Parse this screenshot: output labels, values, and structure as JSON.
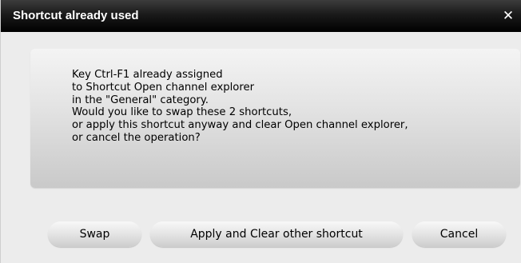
{
  "dialog": {
    "title": "Shortcut already used",
    "close_symbol": "✕",
    "close_icon": "close-icon",
    "message": "Key Ctrl-F1 already assigned\nto Shortcut Open channel explorer\nin the \"General\" category.\nWould you like to swap these 2 shortcuts,\nor apply this shortcut anyway and clear Open channel explorer,\nor cancel the operation?"
  },
  "buttons": {
    "swap_label": "Swap",
    "apply_label": "Apply and Clear other shortcut",
    "cancel_label": "Cancel"
  },
  "colors": {
    "titlebar": "#000000",
    "title_text": "#ffffff",
    "dialog_background": "#ececec"
  }
}
